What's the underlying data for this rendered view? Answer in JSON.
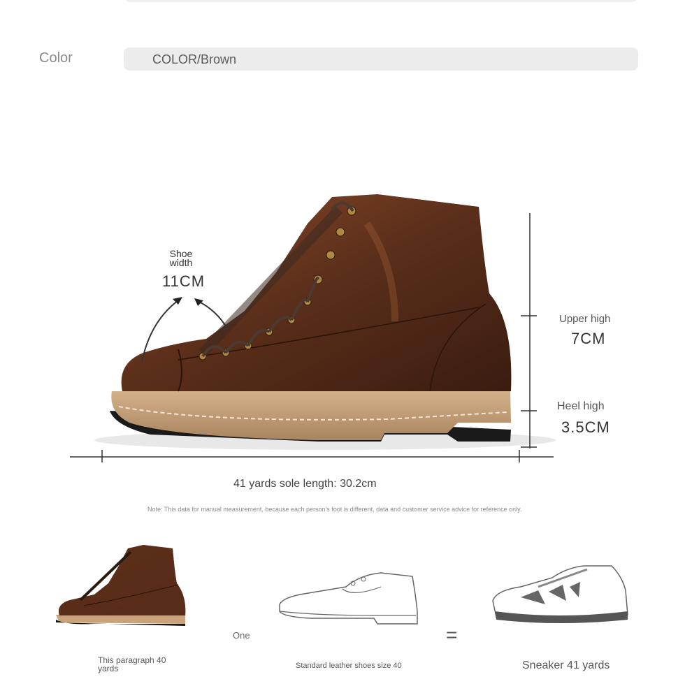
{
  "color": {
    "label": "Color",
    "value": "COLOR/Brown"
  },
  "measurements": {
    "shoe_width_label": "Shoe width",
    "shoe_width_value": "11CM",
    "upper_high_label": "Upper high",
    "upper_high_value": "7CM",
    "heel_high_label": "Heel high",
    "heel_high_value": "3.5CM",
    "sole_length": "41 yards sole length: 30.2cm"
  },
  "note": "Note: This data for manual measurement, because each person's foot is different, data and customer service advice for reference only.",
  "comparison": {
    "boot_caption": "This paragraph 40 yards",
    "one_label": "One",
    "equals": "=",
    "dress_shoe_caption": "Standard leather shoes size 40",
    "sneaker_caption": "Sneaker 41 yards"
  },
  "colors": {
    "leather": "#5a2e1a",
    "leather_light": "#8a4a2a",
    "sole": "#c9a27a",
    "pill": "#ececec"
  }
}
